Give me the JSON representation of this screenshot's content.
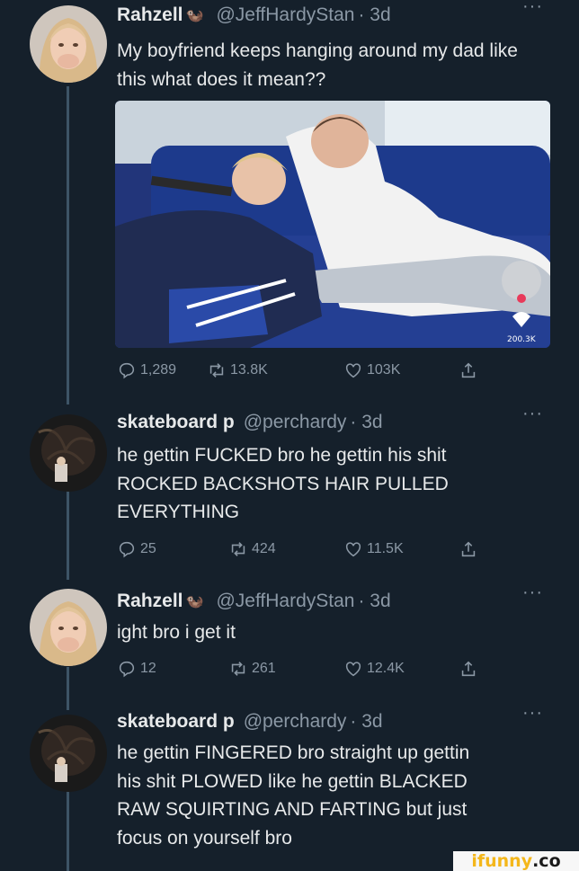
{
  "tweets": [
    {
      "name": "Rahzell",
      "badge": "🦦",
      "handle": "@JeffHardyStan",
      "time": "· 3d",
      "more": "···",
      "lines": [
        "My boyfriend keeps hanging around my dad like",
        "this what does it mean??"
      ],
      "media": {
        "likes_overlay": "200.3K"
      },
      "actions": {
        "replies": "1,289",
        "retweets": "13.8K",
        "likes": "103K"
      }
    },
    {
      "name": "skateboard p",
      "handle": "@perchardy",
      "time": "· 3d",
      "more": "···",
      "lines": [
        " he gettin FUCKED bro  he gettin his shit",
        "ROCKED BACKSHOTS HAIR PULLED",
        "EVERYTHING"
      ],
      "actions": {
        "replies": "25",
        "retweets": "424",
        "likes": "11.5K"
      }
    },
    {
      "name": "Rahzell",
      "badge": "🦦",
      "handle": "@JeffHardyStan",
      "time": "· 3d",
      "more": "···",
      "lines": [
        "ight bro i get it"
      ],
      "actions": {
        "replies": "12",
        "retweets": "261",
        "likes": "12.4K"
      }
    },
    {
      "name": "skateboard p",
      "handle": "@perchardy",
      "time": "· 3d",
      "more": "···",
      "lines": [
        " he gettin FINGERED bro straight up gettin",
        "his shit PLOWED like  he gettin BLACKED",
        "RAW SQUIRTING AND FARTING but just",
        "focus on yourself bro"
      ]
    }
  ],
  "watermark": {
    "main": "ifunny",
    "suffix": ".co"
  }
}
